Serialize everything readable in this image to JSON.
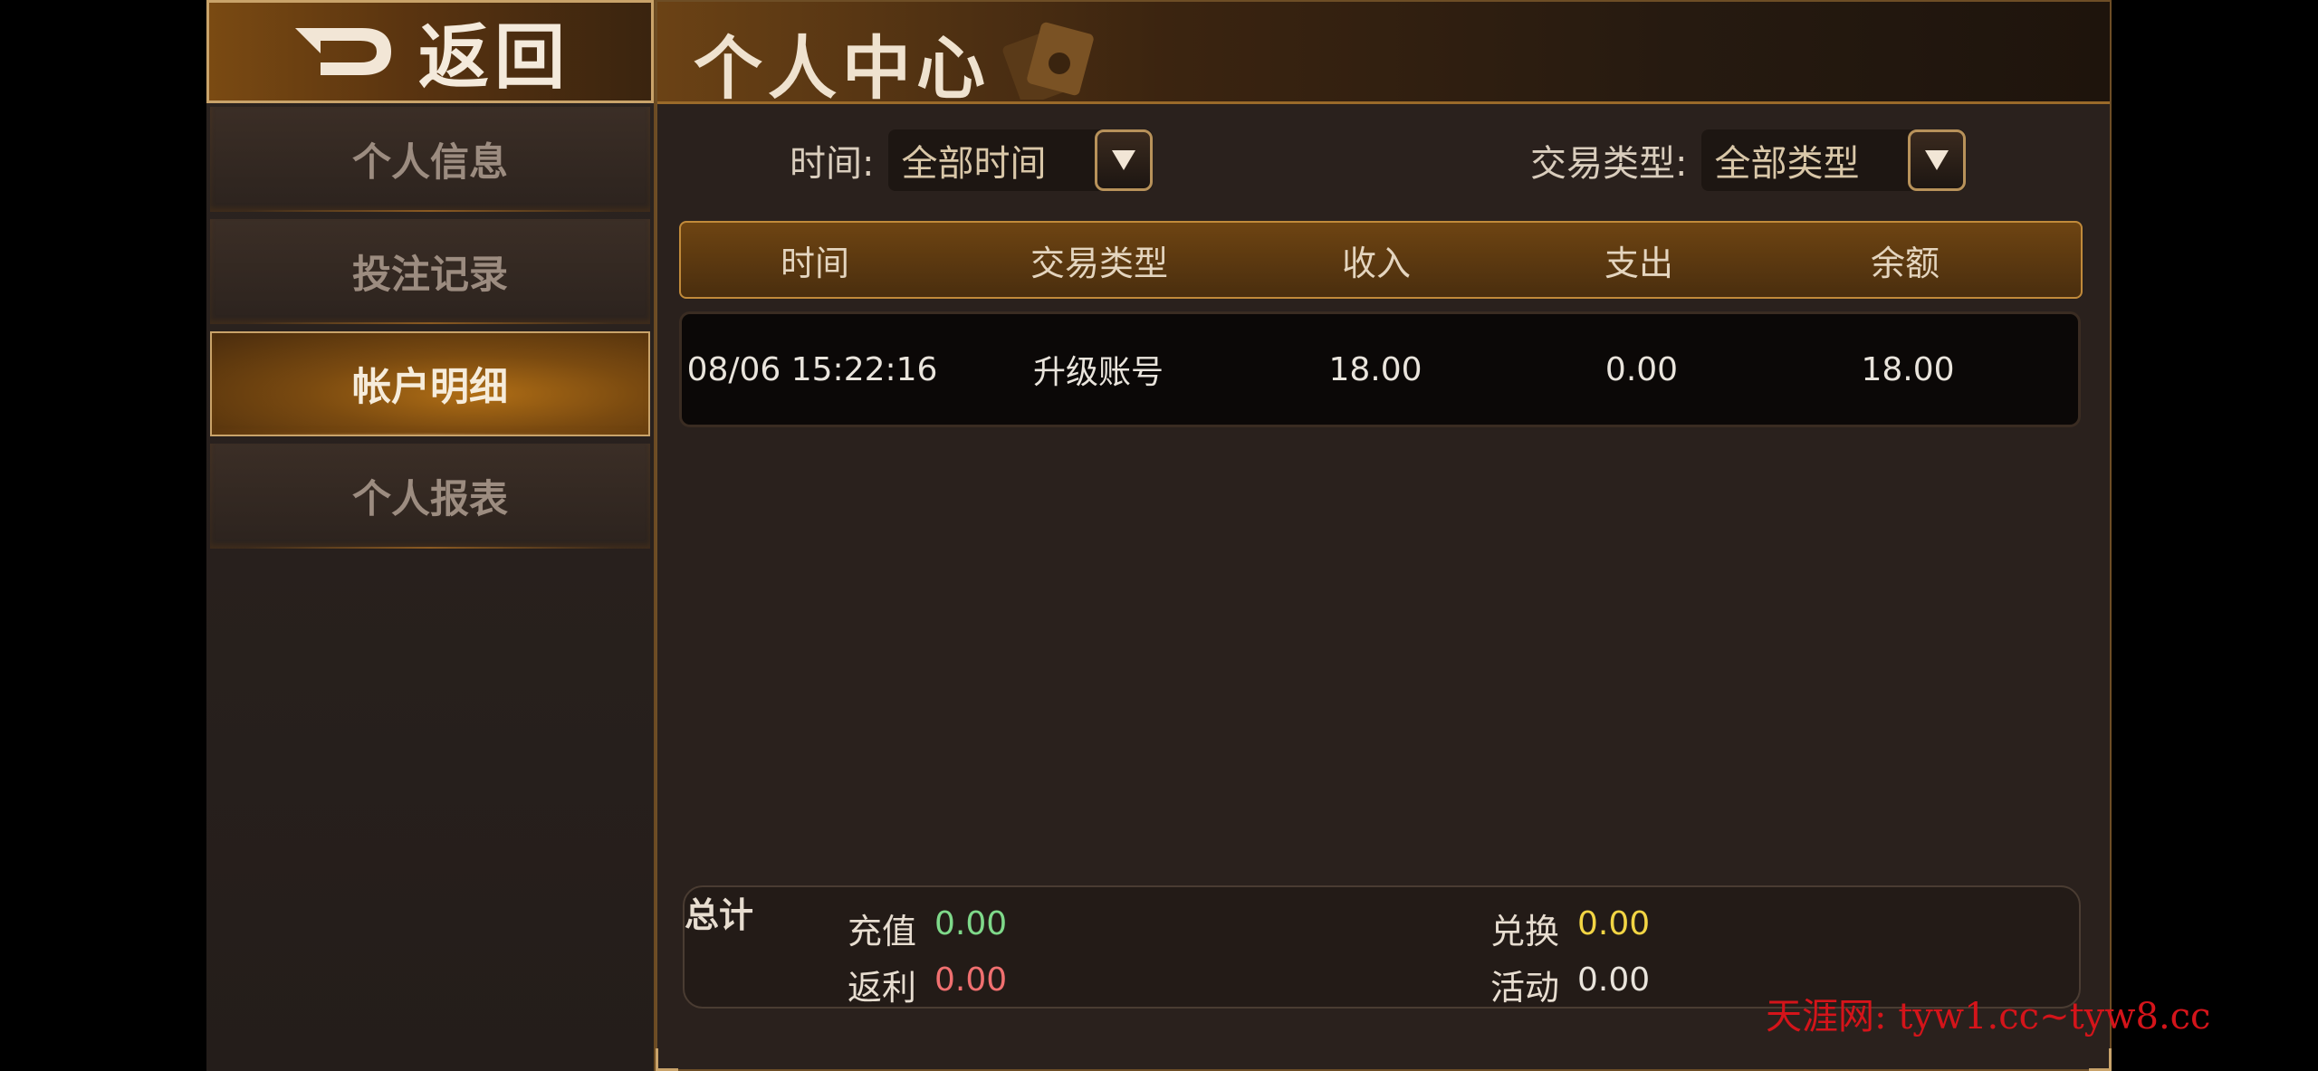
{
  "sidebar": {
    "back_label": "返回",
    "items": [
      {
        "label": "个人信息"
      },
      {
        "label": "投注记录"
      },
      {
        "label": "帐户明细"
      },
      {
        "label": "个人报表"
      }
    ]
  },
  "header": {
    "title": "个人中心"
  },
  "filters": {
    "time": {
      "label": "时间:",
      "value": "全部时间"
    },
    "type": {
      "label": "交易类型:",
      "value": "全部类型"
    }
  },
  "table": {
    "columns": [
      "时间",
      "交易类型",
      "收入",
      "支出",
      "余额"
    ],
    "rows": [
      [
        "08/06 15:22:16",
        "升级账号",
        "18.00",
        "0.00",
        "18.00"
      ]
    ]
  },
  "summary": {
    "title": "总计",
    "recharge": {
      "label": "充值",
      "value": "0.00"
    },
    "rebate": {
      "label": "返利",
      "value": "0.00"
    },
    "exchange": {
      "label": "兑换",
      "value": "0.00"
    },
    "activity": {
      "label": "活动",
      "value": "0.00"
    }
  },
  "colors": {
    "recharge_value": "#7fd98a",
    "rebate_value": "#f07070",
    "exchange_value": "#f2d544",
    "activity_value": "#e9e4dc"
  },
  "watermark": "天涯网: tyw1.cc~tyw8.cc"
}
